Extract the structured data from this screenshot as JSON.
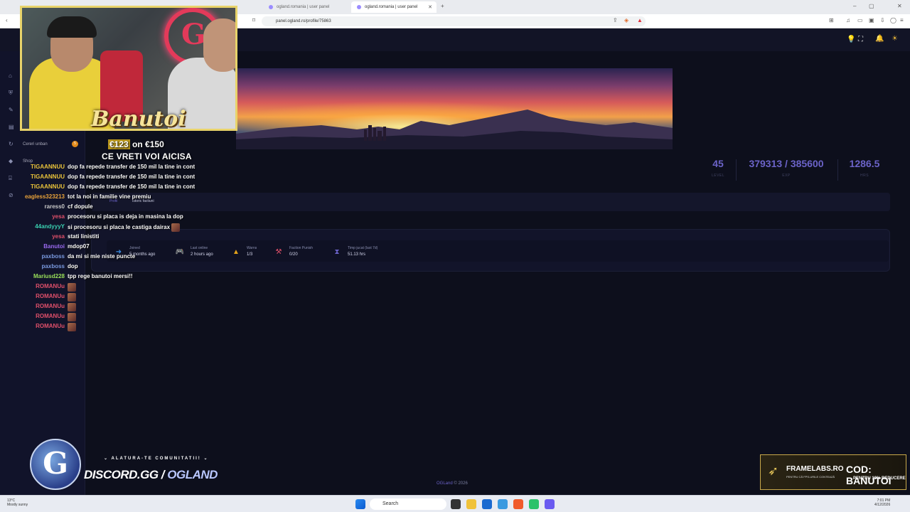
{
  "browser": {
    "tabs": [
      {
        "label": "ogland.romania | user panel"
      },
      {
        "label": "ogland.romania | user panel"
      }
    ],
    "url": "panel.ogland.ro/profile/75863"
  },
  "sidebar": {
    "items": [
      {
        "label": "Cereri unban",
        "badge": "5"
      },
      {
        "label": "Shop"
      }
    ]
  },
  "profile": {
    "stats": [
      {
        "value": "45",
        "label": "LEVEL"
      },
      {
        "value": "379313 / 385600",
        "label": "EXP"
      },
      {
        "value": "1286.5",
        "label": "HRS"
      }
    ],
    "tabs": [
      "Profil",
      "Istoric factiuni"
    ],
    "info": [
      {
        "title": "Joined",
        "value": "5 months ago",
        "icon": "login-icon",
        "color": "#3a8ee6"
      },
      {
        "title": "Last online",
        "value": "2 hours ago",
        "icon": "gamepad-icon",
        "color": "#27c24c"
      },
      {
        "title": "Warns",
        "value": "1/3",
        "icon": "warning-icon",
        "color": "#e3a21a"
      },
      {
        "title": "Faction Punish",
        "value": "0/20",
        "icon": "gavel-icon",
        "color": "#e0506a"
      },
      {
        "title": "Timp jucat (last 7d)",
        "value": "51.13 hrs",
        "icon": "hourglass-icon",
        "color": "#6b63c8"
      }
    ]
  },
  "footer": {
    "brand": "OGLand",
    "text": "© 2026"
  },
  "overlay": {
    "streamer": "Banutoi",
    "goal_current": "€123",
    "goal_text": "on €150",
    "cta": "CE VRETI VOI AICISA",
    "chat": [
      {
        "user": "TIGAANNUU",
        "color": "#e8c23a",
        "text": "dop fa repede transfer de 150 mil la tine in cont"
      },
      {
        "user": "TIGAANNUU",
        "color": "#e8c23a",
        "text": "dop fa repede transfer de 150 mil la tine in cont"
      },
      {
        "user": "TIGAANNUU",
        "color": "#e8c23a",
        "text": "dop fa repede transfer de 150 mil la tine in cont"
      },
      {
        "user": "eagless323213",
        "color": "#e8a23a",
        "text": "tot la noi in familie vine premiu"
      },
      {
        "user": "raress0",
        "color": "#c9c9c9",
        "text": "cf dopule"
      },
      {
        "user": "yesa",
        "color": "#e0506a",
        "text": "procesoru si placa is deja in masina la dop"
      },
      {
        "user": "44andyyyY",
        "color": "#3ad0b0",
        "text": "si procesoru si placa le castiga dairax",
        "emote": true
      },
      {
        "user": "yesa",
        "color": "#e0506a",
        "text": "stati linistiti"
      },
      {
        "user": "Banutoi",
        "color": "#9a6af0",
        "text": "mdop07"
      },
      {
        "user": "paxboss",
        "color": "#7a9ae0",
        "text": "da mi si mie niste puncte"
      },
      {
        "user": "paxboss",
        "color": "#7a9ae0",
        "text": "dop"
      },
      {
        "user": "Mariusd228",
        "color": "#9ae05a",
        "text": "tpp rege banutoi mersi!!"
      },
      {
        "user": "ROMANUu",
        "color": "#e0506a",
        "text": "",
        "emote": true
      },
      {
        "user": "ROMANUu",
        "color": "#e0506a",
        "text": "",
        "emote": true
      },
      {
        "user": "ROMANUu",
        "color": "#e0506a",
        "text": "",
        "emote": true
      },
      {
        "user": "ROMANUu",
        "color": "#e0506a",
        "text": "",
        "emote": true
      },
      {
        "user": "ROMANUu",
        "color": "#e0506a",
        "text": "",
        "emote": true
      }
    ],
    "discord_join": "ALATURA-TE COMUNITATII!",
    "discord_url_prefix": "DISCORD.GG /",
    "discord_url_name": "OGLAND",
    "sponsor_name": "FRAMELABS.RO",
    "sponsor_sub": "PENTRU CĂ FPS-URILE CONTEAZĂ",
    "sponsor_code": "COD: BANUTOI",
    "sponsor_discount": "PENTRU 10% REDUCERE"
  },
  "taskbar": {
    "search_placeholder": "Search",
    "weather_temp": "13°C",
    "weather_desc": "Mostly sunny",
    "time": "7:01 PM",
    "date": "4/12/2026"
  }
}
